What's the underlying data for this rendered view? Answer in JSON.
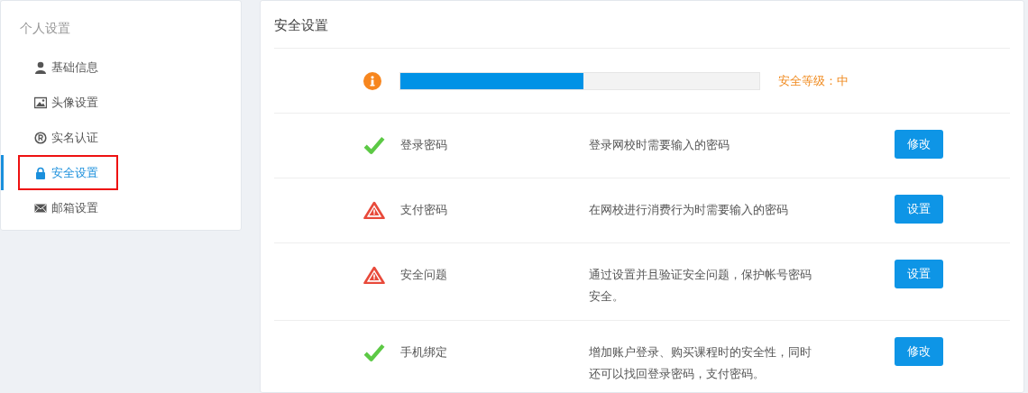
{
  "sidebar": {
    "title": "个人设置",
    "items": [
      {
        "label": "基础信息",
        "kind": "user",
        "selected": false,
        "highlighted": false
      },
      {
        "label": "头像设置",
        "kind": "image",
        "selected": false,
        "highlighted": false
      },
      {
        "label": "实名认证",
        "kind": "registered",
        "selected": false,
        "highlighted": false
      },
      {
        "label": "安全设置",
        "kind": "lock",
        "selected": true,
        "highlighted": true
      },
      {
        "label": "邮箱设置",
        "kind": "mail",
        "selected": false,
        "highlighted": false
      }
    ]
  },
  "main": {
    "title": "安全设置",
    "security_level": {
      "level": 0.51,
      "label": "安全等级：中"
    },
    "rows": [
      {
        "kind": "ok",
        "name": "登录密码",
        "description": "登录网校时需要输入的密码",
        "button": "修改"
      },
      {
        "kind": "warning",
        "name": "支付密码",
        "description": "在网校进行消费行为时需要输入的密码",
        "button": "设置"
      },
      {
        "kind": "warning",
        "name": "安全问题",
        "description": "通过设置并且验证安全问题，保护帐号密码安全。",
        "button": "设置"
      },
      {
        "kind": "ok",
        "name": "手机绑定",
        "description": "增加账户登录、购买课程时的安全性，同时还可以找回登录密码，支付密码。",
        "button": "修改"
      }
    ]
  }
}
